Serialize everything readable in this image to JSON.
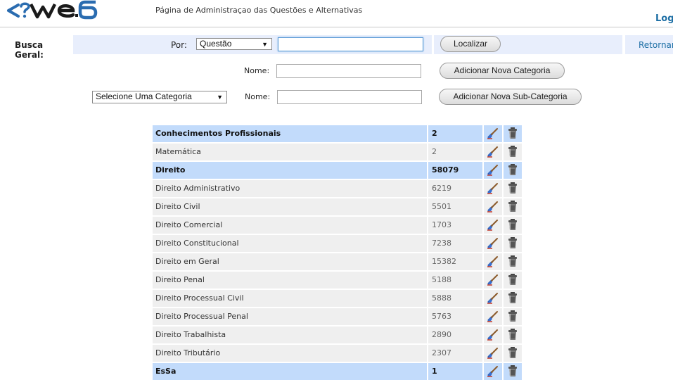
{
  "header": {
    "title": "Página de Administraçao das Questões e Alternativas",
    "logout_label": "Log"
  },
  "search": {
    "label": "Busca Geral:",
    "por_label": "Por:",
    "selected_option": "Questão",
    "query_value": "",
    "button_label": "Localizar",
    "return_label": "Retornar"
  },
  "category_form": {
    "name_label": "Nome:",
    "name_value": "",
    "button_label": "Adicionar Nova Categoria"
  },
  "subcategory_form": {
    "category_select": "Selecione Uma Categoria",
    "name_label": "Nome:",
    "name_value": "",
    "button_label": "Adicionar Nova Sub-Categoria"
  },
  "table": {
    "rows": [
      {
        "type": "cat",
        "name": "Conhecimentos Profissionais",
        "count": "2"
      },
      {
        "type": "sub",
        "name": "Matemática",
        "count": "2"
      },
      {
        "type": "cat",
        "name": "Direito",
        "count": "58079"
      },
      {
        "type": "sub",
        "name": "Direito Administrativo",
        "count": "6219"
      },
      {
        "type": "sub",
        "name": "Direito Civil",
        "count": "5501"
      },
      {
        "type": "sub",
        "name": "Direito Comercial",
        "count": "1703"
      },
      {
        "type": "sub",
        "name": "Direito Constitucional",
        "count": "7238"
      },
      {
        "type": "sub",
        "name": "Direito em Geral",
        "count": "15382"
      },
      {
        "type": "sub",
        "name": "Direito Penal",
        "count": "5188"
      },
      {
        "type": "sub",
        "name": "Direito Processual Civil",
        "count": "5888"
      },
      {
        "type": "sub",
        "name": "Direito Processual Penal",
        "count": "5763"
      },
      {
        "type": "sub",
        "name": "Direito Trabalhista",
        "count": "2890"
      },
      {
        "type": "sub",
        "name": "Direito Tributário",
        "count": "2307"
      },
      {
        "type": "cat",
        "name": "EsSa",
        "count": "1"
      }
    ],
    "edit_icon": "edit-brush-icon",
    "delete_icon": "trash-can-icon"
  },
  "colors": {
    "category_row": "#c2dbfb",
    "subcategory_row": "#efefef",
    "search_bar": "#e8eefc",
    "logo": "#2a6cb0",
    "link": "#1d6fa5"
  }
}
